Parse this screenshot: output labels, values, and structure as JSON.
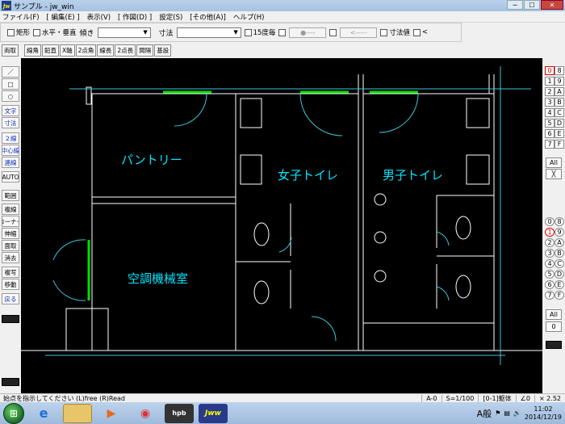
{
  "window": {
    "title": "サンプル - jw_win",
    "app_icon": "jw"
  },
  "window_controls": [
    "─",
    "☐",
    "✕"
  ],
  "menu": [
    "ファイル(F)",
    "[ 編集(E) ]",
    "表示(V)",
    "[ 作図(D) ]",
    "設定(S)",
    "[その他(A)]",
    "ヘルプ(H)"
  ],
  "options": {
    "rect": "矩形",
    "hv": "水平・垂直",
    "slope": "傾き",
    "dim": "寸法",
    "angle15": "15度毎",
    "btn_circle": "●----",
    "btn_arrow": "<-----",
    "dim_value": "寸法値",
    "lt": "<"
  },
  "function_bar": [
    "両取",
    "線角",
    "鉛直",
    "X軸",
    "2点角",
    "線長",
    "2点長",
    "間隔",
    "基設"
  ],
  "left_tools": [
    "／",
    "□",
    "○",
    "文字",
    "寸法",
    "２線",
    "中心線",
    "連線",
    "AUTO",
    "範囲",
    "複線",
    "コーナー",
    "伸縮",
    "面取",
    "消去",
    "複写",
    "移動",
    "戻る"
  ],
  "layer_groups_top": [
    "0",
    "8",
    "1",
    "9",
    "2",
    "A",
    "3",
    "B",
    "4",
    "C",
    "5",
    "D",
    "6",
    "E",
    "7",
    "F"
  ],
  "layers_bottom": [
    "0",
    "8",
    "1",
    "9",
    "2",
    "A",
    "3",
    "B",
    "4",
    "C",
    "5",
    "D",
    "6",
    "E",
    "7",
    "F"
  ],
  "right_misc": {
    "all_top": "All",
    "x_top": "╳",
    "all_bottom": "All",
    "zero_bottom": "0"
  },
  "room_labels": {
    "pantry": "パントリー",
    "mech": "空調機械室",
    "womens": "女子トイレ",
    "mens": "男子トイレ"
  },
  "colors": {
    "canvas": "#000000",
    "walls": "#ffffff",
    "text": "#00e5ff",
    "window": "#00e000",
    "door_arc": "#3cc6d8"
  },
  "status": {
    "message": "始点を指示してください (L)free (R)Read",
    "layer": "A-0",
    "scale": "S=1/100",
    "group": "[0-1]躯体",
    "angle": "∠0",
    "zoom": "× 2.52"
  },
  "taskbar": {
    "apps": [
      "IE",
      "Explorer",
      "Media",
      "Chrome",
      "hpb",
      "Jww"
    ],
    "ime": "A般",
    "time": "11:02",
    "date": "2014/12/19"
  }
}
